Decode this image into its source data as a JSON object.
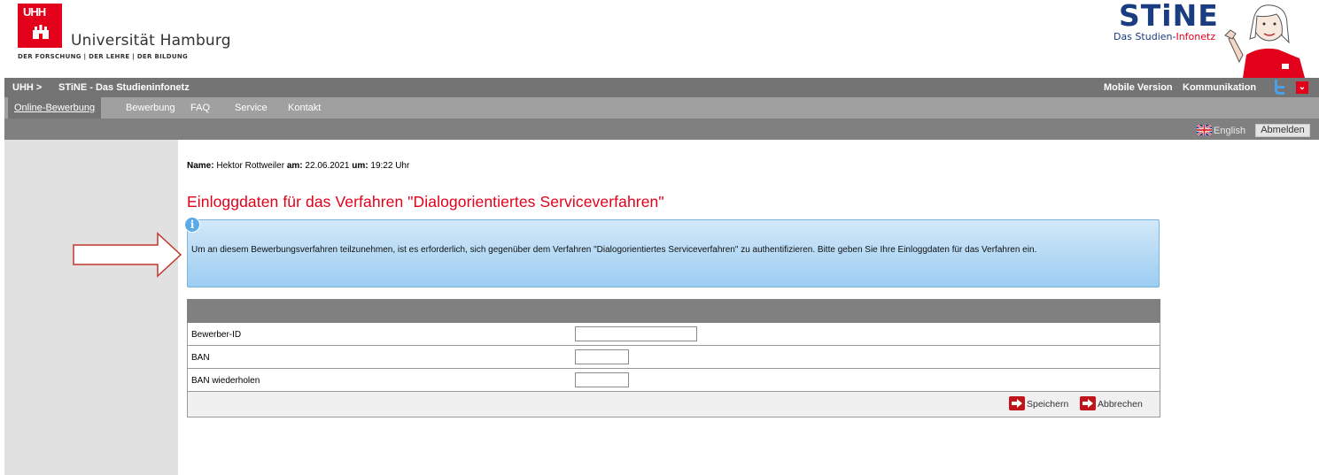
{
  "header": {
    "uhh_logo_text": "UHH",
    "university_name": "Universität Hamburg",
    "university_tagline": "DER FORSCHUNG | DER LEHRE | DER BILDUNG",
    "stine_word": "STiNE",
    "stine_sub_a": "Das Studien-",
    "stine_sub_b": "Infonetz"
  },
  "topbar": {
    "crumb_home": "UHH >",
    "crumb_current": "STiNE - Das Studieninfonetz",
    "mobile": "Mobile Version",
    "communication": "Kommunikation",
    "dropdown_icon": "chevron-down-icon"
  },
  "nav": {
    "tabs": [
      {
        "label": "Online-Bewerbung",
        "active": true
      },
      {
        "label": "Bewerbung"
      },
      {
        "label": "FAQ"
      },
      {
        "label": "Service"
      },
      {
        "label": "Kontakt"
      }
    ]
  },
  "toolbar": {
    "language_label": "English",
    "logout_label": "Abmelden"
  },
  "userline": {
    "name_label": "Name:",
    "name_value": "Hektor Rottweiler",
    "date_label": "am:",
    "date_value": "22.06.2021",
    "time_label": "um:",
    "time_value": "19:22 Uhr"
  },
  "page_title": "Einloggdaten für das Verfahren \"Dialogorientiertes Serviceverfahren\"",
  "info": {
    "icon": "info-icon",
    "text": "Um an diesem Bewerbungsverfahren teilzunehmen, ist es erforderlich, sich gegenüber dem Verfahren \"Dialogorientiertes Serviceverfahren\" zu authentifizieren. Bitte geben Sie Ihre Einloggdaten für das Verfahren ein."
  },
  "form": {
    "fields": [
      {
        "label": "Bewerber-ID",
        "value": ""
      },
      {
        "label": "BAN",
        "value": ""
      },
      {
        "label": "BAN wiederholen",
        "value": ""
      }
    ],
    "save_label": "Speichern",
    "cancel_label": "Abbrechen"
  },
  "colors": {
    "uhh_red": "#e2001a",
    "stine_blue": "#1a3c80",
    "bar_gray": "#747474",
    "info_blue": "#9ccdf2"
  }
}
